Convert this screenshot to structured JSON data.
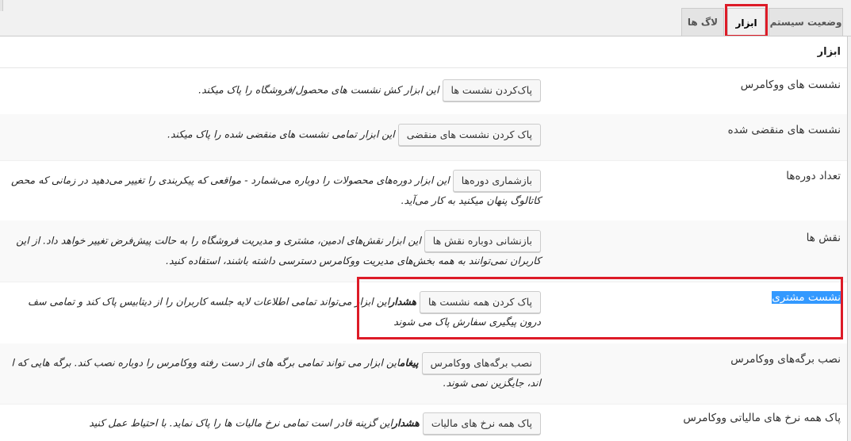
{
  "tabs": [
    {
      "label": "وضعیت سیستم",
      "active": false
    },
    {
      "label": "ابزار",
      "active": true
    },
    {
      "label": "لاگ ها",
      "active": false
    }
  ],
  "section_title": "ابزار",
  "rows": [
    {
      "label": "نشست های ووکامرس",
      "button": "پاک‌کردن نشست ها",
      "desc_bold": "",
      "desc": "این ابزار کش نشست های محصول/فروشگاه را پاک میکند.",
      "desc2": ""
    },
    {
      "label": "نشست های منقضی شده",
      "button": "پاک کردن نشست های منقضی",
      "desc_bold": "",
      "desc": "این ابزار تمامی نشست های منقضی شده را پاک میکند.",
      "desc2": ""
    },
    {
      "label": "تعداد دوره‌ها",
      "button": "بازشماری دوره‌ها",
      "desc_bold": "",
      "desc": "این ابزار دوره‌های محصولات را دوباره می‌شمارد - مواقعی که پیکربندی را تغییر می‌دهید در زمانی که محص",
      "desc2": "کاتالوگ پنهان میکنید به کار می‌آید."
    },
    {
      "label": "نقش ها",
      "button": "بازنشانی دوباره نقش ها",
      "desc_bold": "",
      "desc": "این ابزار نقش‌های ادمین، مشتری و مدیریت فروشگاه را به حالت پیش‌فرض تغییر خواهد داد. از این",
      "desc2": "کاربران نمی‌توانند به همه بخش‌های مدیریت ووکامرس دسترسی داشته باشند، استفاده کنید."
    },
    {
      "label": "نشست مشتری",
      "button": "پاک کردن همه نشست ها",
      "desc_bold": "هشدار",
      "desc": "این ابزار می‌تواند تمامی اطلاعات لایه جلسه کاربران را از دیتابیس پاک کند و تمامی سف",
      "desc2": "درون پیگیری سفارش پاک می شوند"
    },
    {
      "label": "نصب برگه‌های ووکامرس",
      "button": "نصب برگه‌های ووکامرس",
      "desc_bold": "پیغام",
      "desc": "این ابزار می تواند تمامی برگه های از دست رفته ووکامرس را دوباره نصب کند. برگه هایی که ا",
      "desc2": "اند، جایگزین نمی شوند."
    },
    {
      "label": "پاک همه نرخ های مالیاتی ووکامرس",
      "button": "پاک همه نرخ های مالیات",
      "desc_bold": "هشدار",
      "desc": "این گزینه قادر است تمامی نرخ مالیات ها را پاک نماید. با احتیاط عمل کنید",
      "desc2": ""
    }
  ],
  "colors": {
    "highlight_box": "#dd1b27",
    "selection": "#3399ff"
  }
}
